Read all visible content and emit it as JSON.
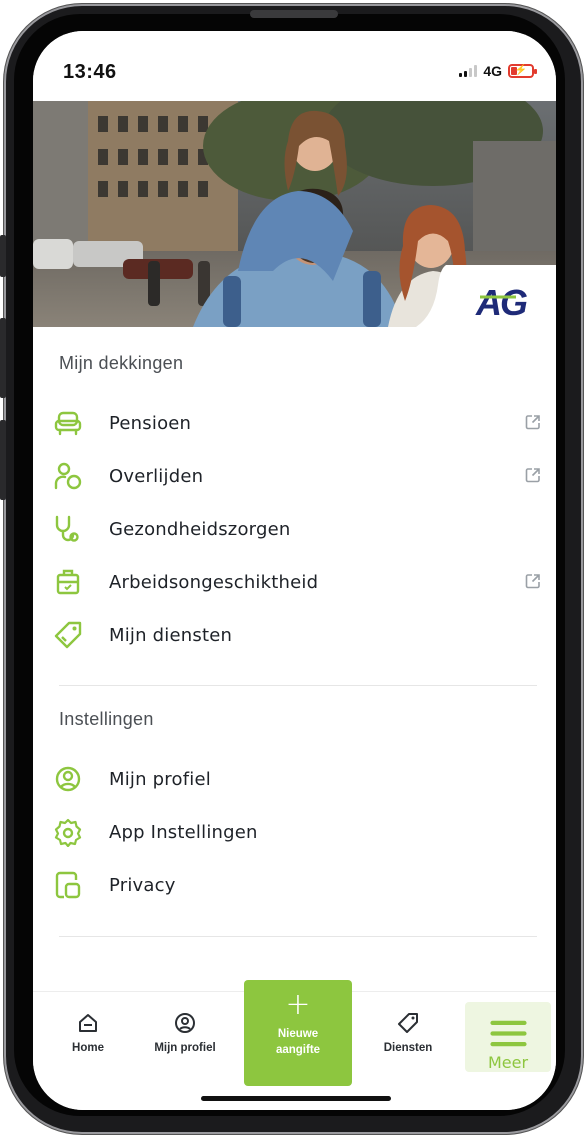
{
  "status": {
    "time": "13:46",
    "network": "4G",
    "battery_state": "low-charging"
  },
  "hero": {
    "logo_text": "AG",
    "brand_color": "#1e2a78",
    "accent_color": "#8dc63f"
  },
  "coverage": {
    "title": "Mijn dekkingen",
    "items": [
      {
        "label": "Pensioen",
        "icon": "armchair-icon",
        "external": true
      },
      {
        "label": "Overlijden",
        "icon": "person-circle-icon",
        "external": true
      },
      {
        "label": "Gezondheidszorgen",
        "icon": "stethoscope-icon",
        "external": false
      },
      {
        "label": "Arbeidsongeschiktheid",
        "icon": "work-incapacity-icon",
        "external": true
      },
      {
        "label": "Mijn diensten",
        "icon": "tag-icon",
        "external": false
      }
    ]
  },
  "settings": {
    "title": "Instellingen",
    "items": [
      {
        "label": "Mijn profiel",
        "icon": "profile-icon"
      },
      {
        "label": "App Instellingen",
        "icon": "gear-icon"
      },
      {
        "label": "Privacy",
        "icon": "privacy-icon"
      }
    ]
  },
  "tabbar": {
    "home": "Home",
    "profile": "Mijn profiel",
    "new_line1": "Nieuwe",
    "new_line2": "aangifte",
    "services": "Diensten",
    "more": "Meer",
    "active": "Meer"
  }
}
